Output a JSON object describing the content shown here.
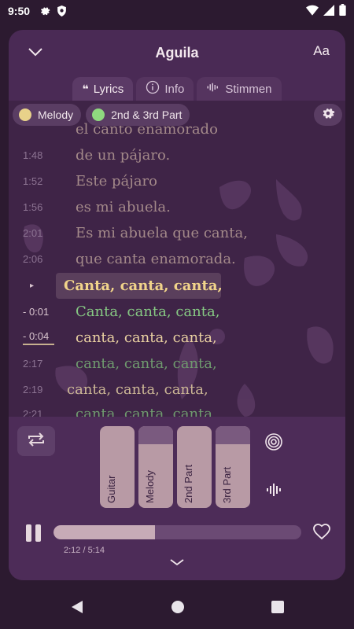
{
  "status": {
    "time": "9:50"
  },
  "header": {
    "title": "Aguila",
    "text_size_label": "Aa"
  },
  "tabs": [
    {
      "label": "Lyrics",
      "icon": "quote-icon",
      "active": true
    },
    {
      "label": "Info",
      "icon": "info-icon",
      "active": false
    },
    {
      "label": "Stimmen",
      "icon": "waveform-icon",
      "active": false
    }
  ],
  "voices": [
    {
      "label": "Melody",
      "color": "#e8d28a"
    },
    {
      "label": "2nd & 3rd Part",
      "color": "#8fd97f"
    }
  ],
  "lyrics": [
    {
      "time": "",
      "text": "el canto enamorado"
    },
    {
      "time": "1:48",
      "text": "de un pájaro."
    },
    {
      "time": "1:52",
      "text": "Este pájaro"
    },
    {
      "time": "1:56",
      "text": "es mi abuela."
    },
    {
      "time": "2:01",
      "text": "Es mi abuela que canta,"
    },
    {
      "time": "2:06",
      "text": "que canta enamorada."
    },
    {
      "time": "▸",
      "text": "Canta, canta, canta,"
    },
    {
      "time": "- 0:01",
      "text": "Canta, canta, canta,"
    },
    {
      "time": "- 0:04",
      "text": "canta, canta, canta,"
    },
    {
      "time": "2:17",
      "text": "canta, canta, canta,"
    },
    {
      "time": "2:19",
      "text": "canta, canta, canta,"
    },
    {
      "time": "2:21",
      "text": "canta, canta, canta"
    }
  ],
  "faders": [
    {
      "label": "Guitar",
      "level": 1.0
    },
    {
      "label": "Melody",
      "level": 0.78
    },
    {
      "label": "2nd Part",
      "level": 1.0
    },
    {
      "label": "3rd Part",
      "level": 0.78
    }
  ],
  "player": {
    "progress": 0.41,
    "time_readout": "2:12 / 5:14"
  },
  "colors": {
    "accent_cream": "#f1d48a",
    "accent_green": "#86c883",
    "panel": "#4a2a55"
  }
}
